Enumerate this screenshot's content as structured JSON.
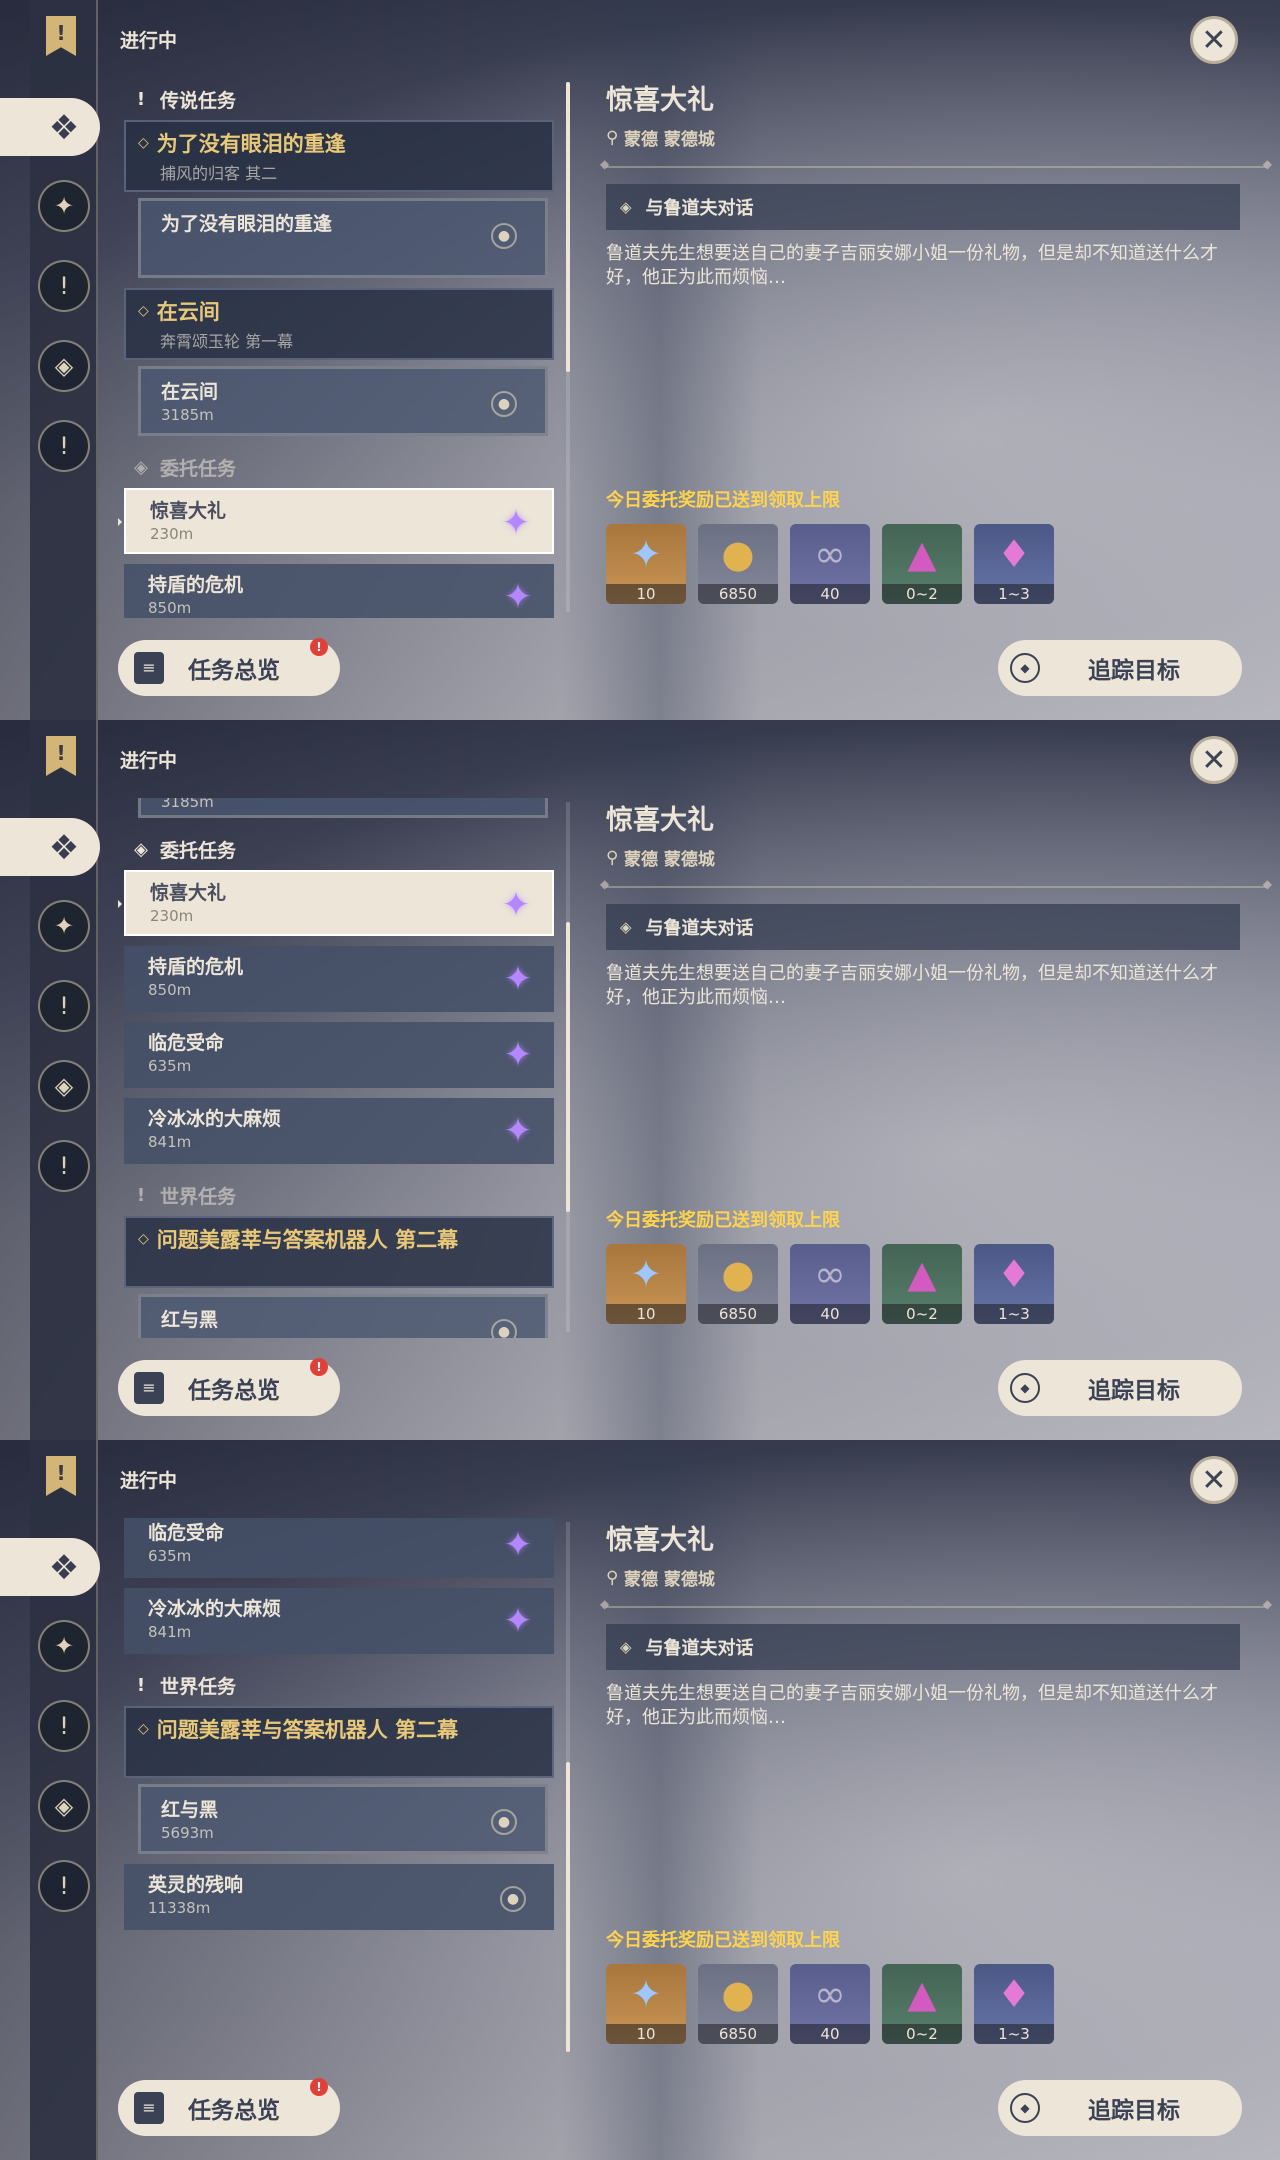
{
  "header": {
    "status": "进行中"
  },
  "rail_icons": [
    "bookmark-icon",
    "commission-icon",
    "archon-icon",
    "story-icon",
    "world-icon",
    "exclaim-icon"
  ],
  "sections": {
    "legend": "传说任务",
    "commission": "委托任务",
    "world": "世界任务"
  },
  "legend_quests": [
    {
      "title": "为了没有眼泪的重逢",
      "subtitle": "捕风的归客 其二",
      "step": {
        "title": "为了没有眼泪的重逢",
        "distance": ""
      }
    },
    {
      "title": "在云间",
      "subtitle": "奔霄颂玉轮 第一幕",
      "step": {
        "title": "在云间",
        "distance": "3185m"
      }
    }
  ],
  "commissions": [
    {
      "title": "惊喜大礼",
      "distance": "230m",
      "selected": true
    },
    {
      "title": "持盾的危机",
      "distance": "850m",
      "selected": false
    },
    {
      "title": "临危受命",
      "distance": "635m",
      "selected": false
    },
    {
      "title": "冷冰冰的大麻烦",
      "distance": "841m",
      "selected": false
    }
  ],
  "world_quest": {
    "title": "问题美露莘与答案机器人 第二幕",
    "steps": [
      {
        "title": "红与黑",
        "distance": "5693m"
      }
    ]
  },
  "extra_quest": {
    "title": "英灵的残响",
    "distance": "11338m"
  },
  "buttons": {
    "overview": "任务总览",
    "overview_badge": "!",
    "track": "追踪目标"
  },
  "detail": {
    "title": "惊喜大礼",
    "location": "蒙德 蒙德城",
    "objective": "与鲁道夫对话",
    "description": "鲁道夫先生想要送自己的妻子吉丽安娜小姐一份礼物，但是却不知道送什么才好，他正为此而烦恼…",
    "reward_note": "今日委托奖励已送到领取上限",
    "rewards": [
      {
        "icon": "primogem-icon",
        "count": "10"
      },
      {
        "icon": "mora-icon",
        "count": "6850"
      },
      {
        "icon": "adventure-exp-icon",
        "count": "40"
      },
      {
        "icon": "ore-icon",
        "count": "0~2"
      },
      {
        "icon": "crystal-icon",
        "count": "1~3"
      }
    ]
  }
}
